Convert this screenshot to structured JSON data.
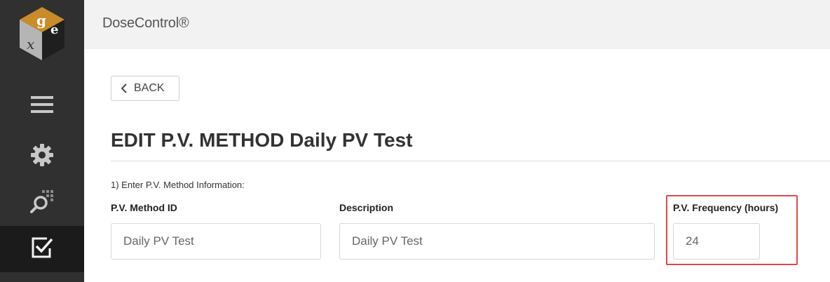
{
  "app": {
    "brand": "DoseControl®"
  },
  "sidebar": {
    "logo": {
      "letters": "g e x"
    },
    "items": [
      {
        "icon": "menu-icon"
      },
      {
        "icon": "gear-icon"
      },
      {
        "icon": "search-grid-icon"
      },
      {
        "icon": "checkbox-icon",
        "active": true
      }
    ]
  },
  "toolbar": {
    "back_label": "BACK"
  },
  "page": {
    "title": "EDIT P.V. METHOD Daily PV Test",
    "section_label": "1) Enter P.V. Method Information:"
  },
  "form": {
    "method_id": {
      "label": "P.V. Method ID",
      "value": "Daily PV Test"
    },
    "description": {
      "label": "Description",
      "value": "Daily PV Test"
    },
    "frequency": {
      "label": "P.V. Frequency (hours)",
      "value": "24"
    }
  },
  "colors": {
    "sidebar": "#303030",
    "sidebar_active": "#1b1b1b",
    "topbar": "#f2f2f2",
    "highlight": "#e0484a"
  }
}
